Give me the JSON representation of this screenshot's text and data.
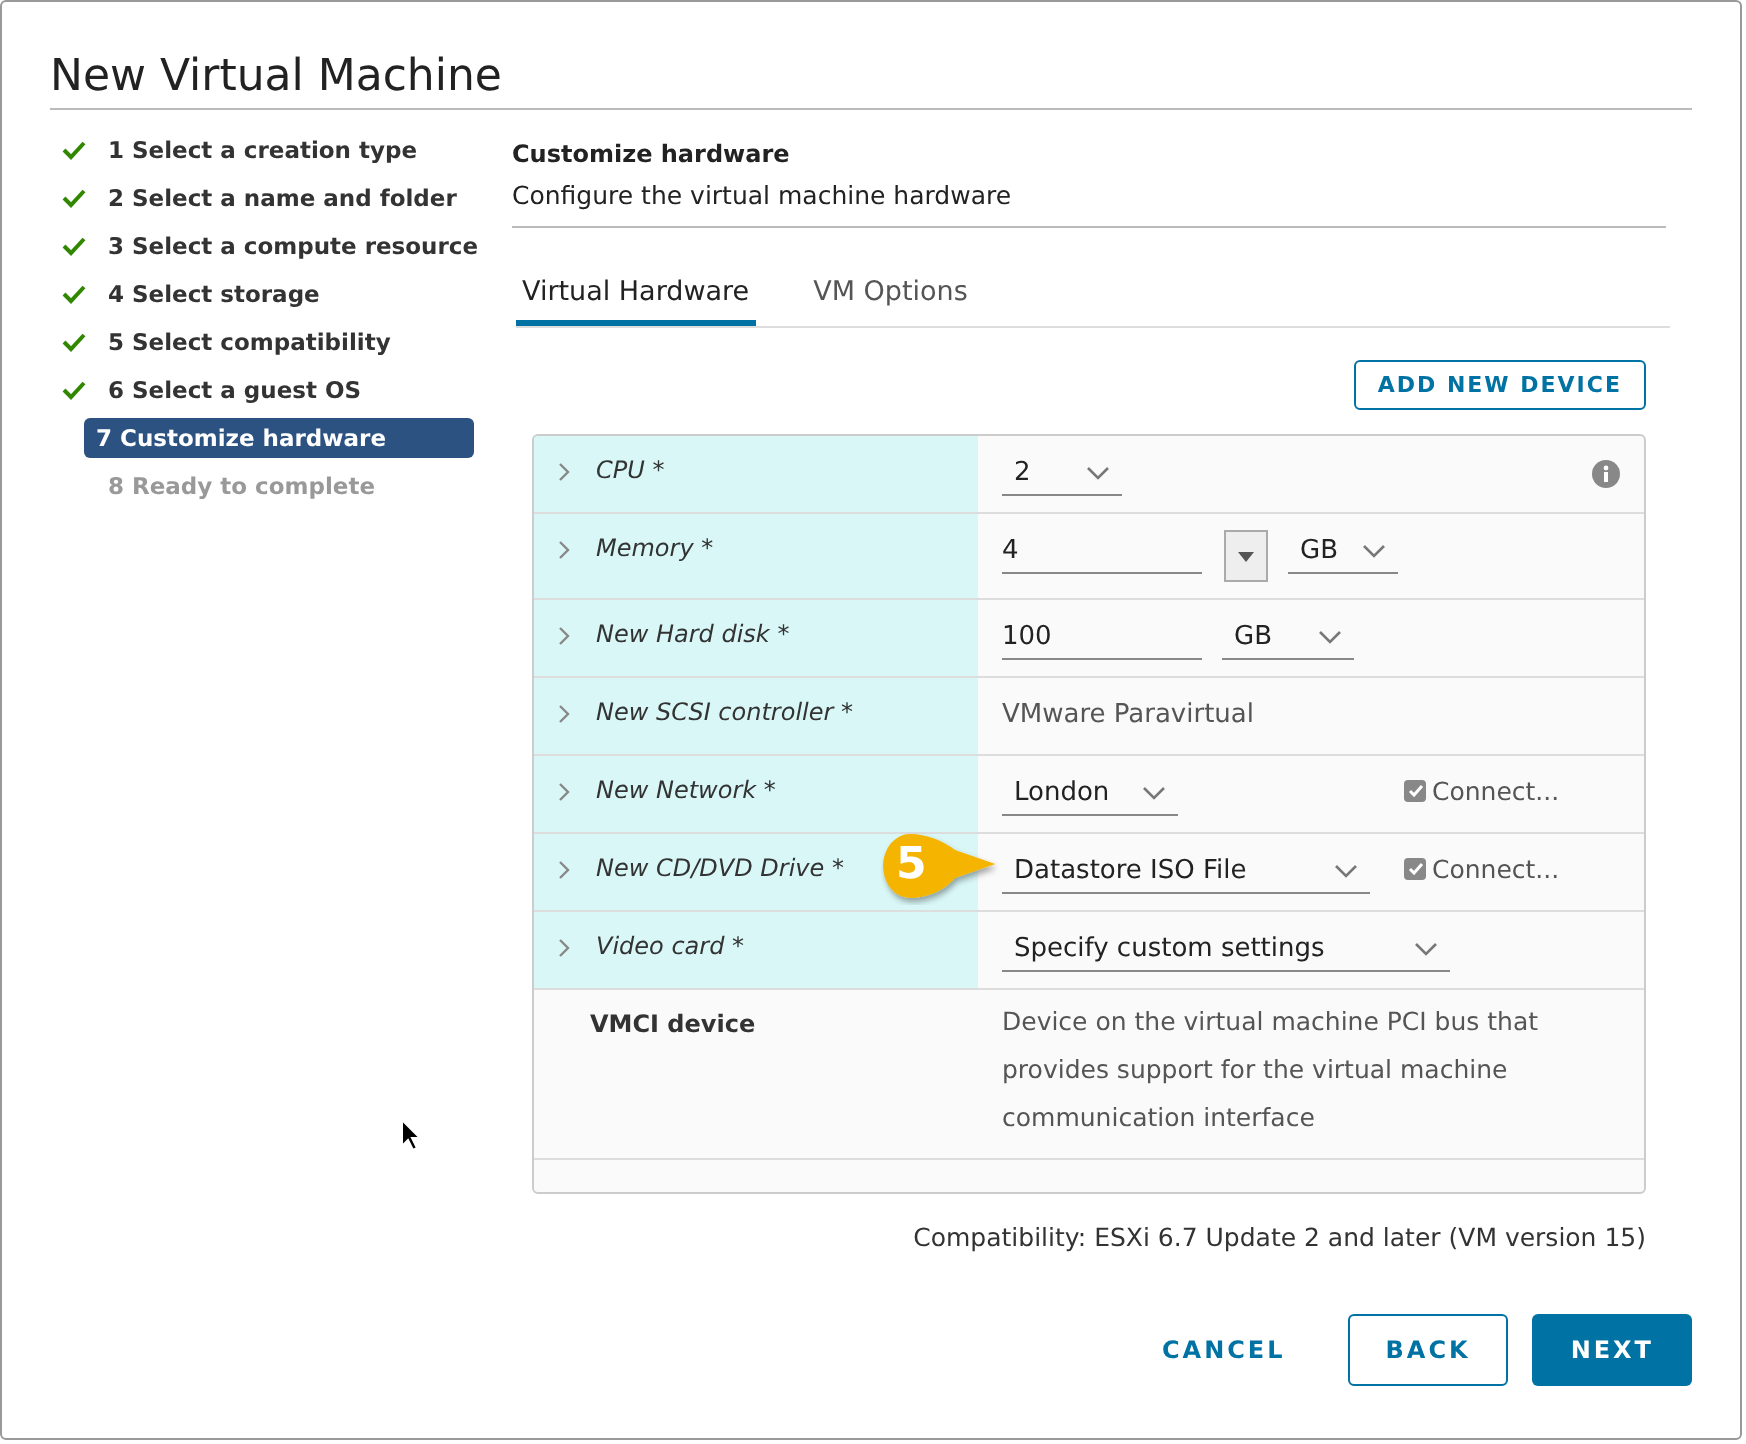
{
  "window": {
    "title": "New Virtual Machine"
  },
  "steps": [
    {
      "label": "1 Select a creation type",
      "completed": true,
      "selected": false
    },
    {
      "label": "2 Select a name and folder",
      "completed": true,
      "selected": false
    },
    {
      "label": "3 Select a compute resource",
      "completed": true,
      "selected": false
    },
    {
      "label": "4 Select storage",
      "completed": true,
      "selected": false
    },
    {
      "label": "5 Select compatibility",
      "completed": true,
      "selected": false
    },
    {
      "label": "6 Select a guest OS",
      "completed": true,
      "selected": false
    },
    {
      "label": "7 Customize hardware",
      "completed": false,
      "selected": true
    },
    {
      "label": "8 Ready to complete",
      "completed": false,
      "selected": false
    }
  ],
  "header": {
    "title": "Customize hardware",
    "subtitle": "Configure the virtual machine hardware"
  },
  "tabs": [
    {
      "label": "Virtual Hardware",
      "selected": true
    },
    {
      "label": "VM Options",
      "selected": false
    }
  ],
  "add_button": "ADD NEW DEVICE",
  "hardware": [
    {
      "kind": "select",
      "label": "CPU *",
      "value": "2",
      "expanded": false,
      "highlighted": true,
      "info": true
    },
    {
      "kind": "amount",
      "label": "Memory *",
      "value": "4",
      "unit": "GB",
      "expanded": false,
      "highlighted": true
    },
    {
      "kind": "size",
      "label": "New Hard disk *",
      "value": "100",
      "unit": "GB",
      "expanded": false,
      "highlighted": true
    },
    {
      "kind": "text",
      "label": "New SCSI controller *",
      "value": "VMware Paravirtual",
      "expanded": false,
      "highlighted": true
    },
    {
      "kind": "select",
      "label": "New Network *",
      "value": "London",
      "expanded": false,
      "highlighted": true,
      "connect": {
        "label": "Connect...",
        "checked": true
      }
    },
    {
      "kind": "select",
      "label": "New CD/DVD Drive *",
      "value": "Datastore ISO File",
      "expanded": false,
      "highlighted": true,
      "connect": {
        "label": "Connect...",
        "checked": true
      },
      "callout": "5"
    },
    {
      "kind": "select",
      "label": "Video card *",
      "value": "Specify custom settings",
      "expanded": false,
      "highlighted": true
    },
    {
      "kind": "device",
      "label": "VMCI device",
      "value": "Device on the virtual machine PCI bus that provides support for the virtual machine communication interface",
      "highlighted": false
    }
  ],
  "compatibility": "Compatibility: ESXi 6.7 Update 2 and later (VM version 15)",
  "buttons": [
    {
      "label": "CANCEL",
      "kind": "flat"
    },
    {
      "label": "BACK",
      "kind": "outline"
    },
    {
      "label": "NEXT",
      "kind": "primary"
    }
  ]
}
